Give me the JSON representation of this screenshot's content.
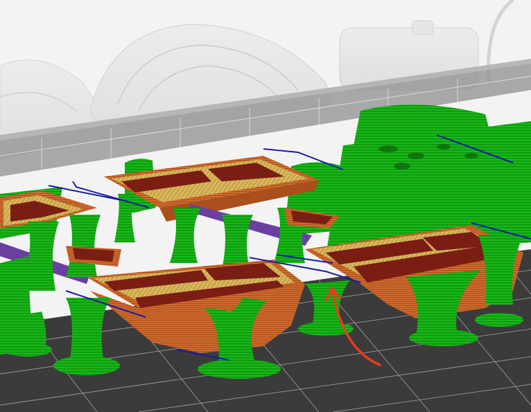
{
  "viewport": {
    "title": "",
    "colors": {
      "background": "#f2f2f2",
      "bed": "#3c3c3c",
      "bed_grid": "#bdbdbd",
      "support": "#16b816",
      "support_dark": "#0c7a0c",
      "perimeter": "#d4682c",
      "infill": "#c9a64a",
      "overhang": "#7a1e14",
      "bridge": "#6b3fa0",
      "travel": "#1a1aa8",
      "annotation_arrow": "#ee3a1d",
      "ghost_model": "#c8c8c8"
    },
    "legend_features": [
      "support-material",
      "external-perimeter",
      "solid-infill",
      "overhang-perimeter",
      "bridge-infill",
      "travel-move"
    ]
  }
}
